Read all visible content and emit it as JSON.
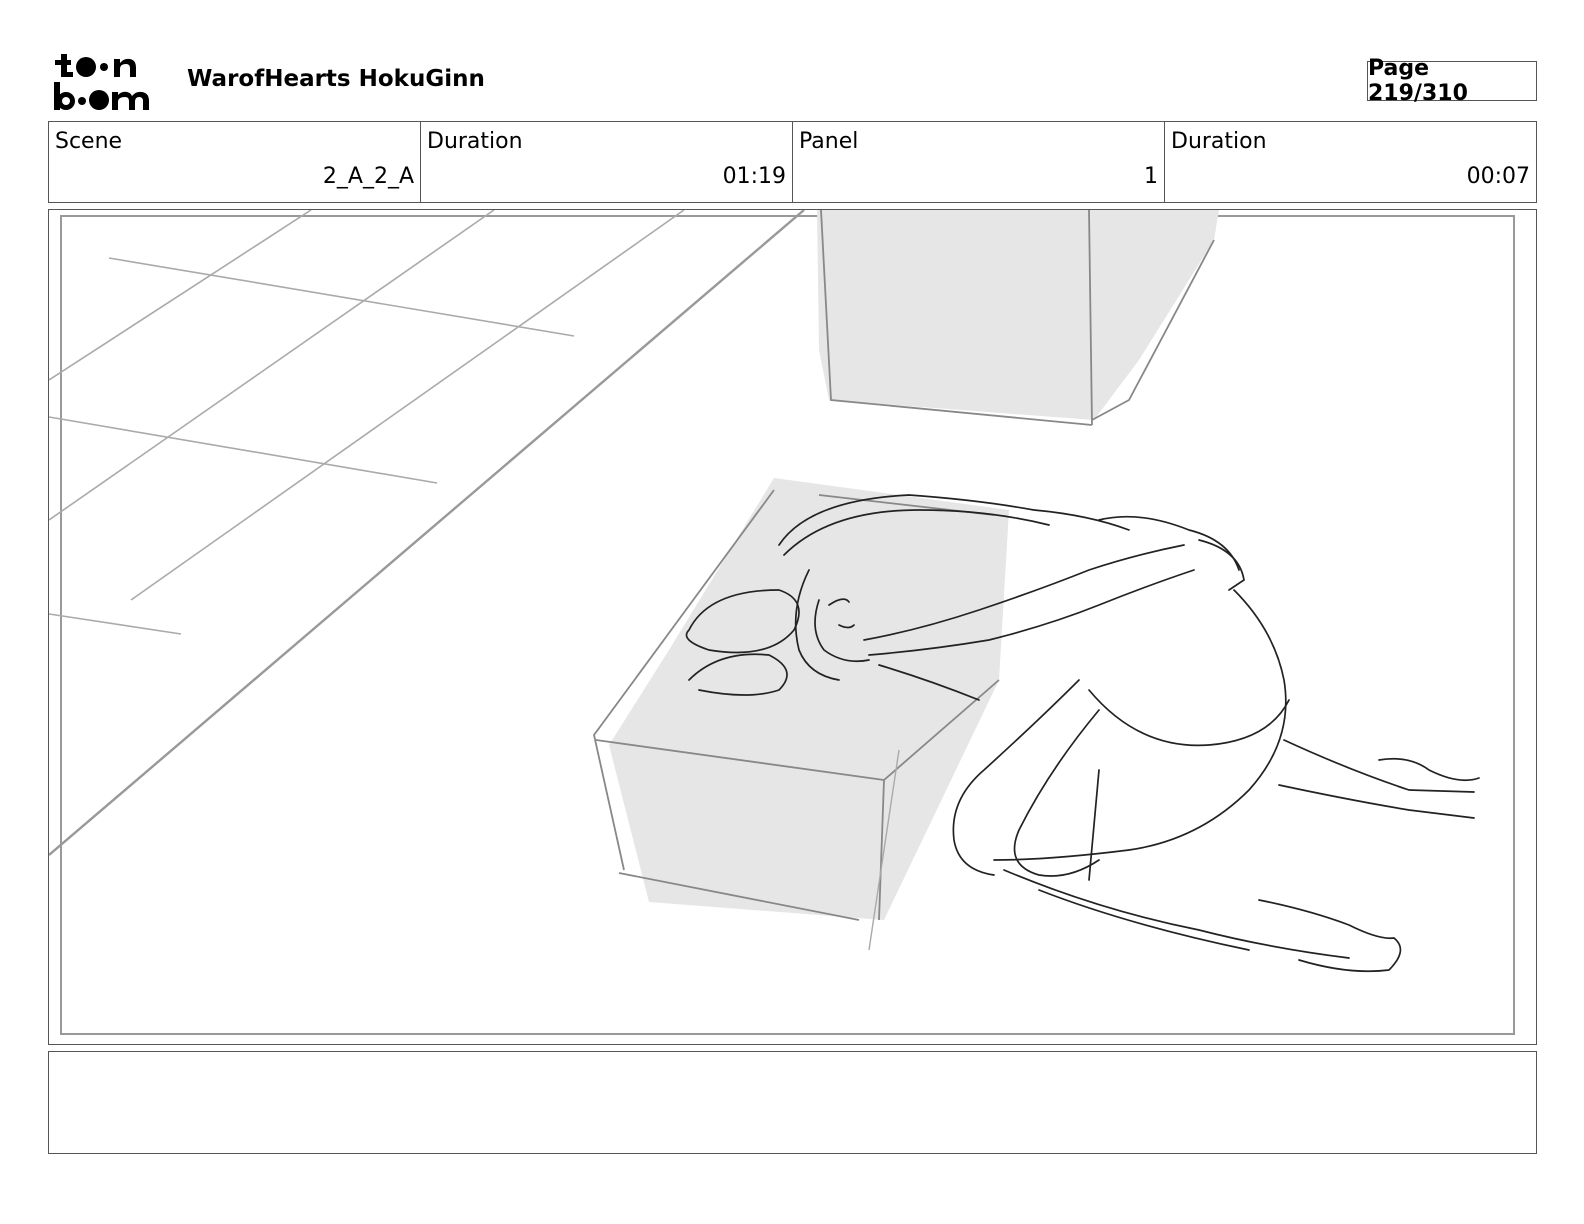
{
  "header": {
    "logo_text": "toon boom",
    "project_title": "WarofHearts HokuGinn",
    "page_label": "Page 219/310"
  },
  "info": {
    "scene_label": "Scene",
    "scene_value": "2_A_2_A",
    "scene_duration_label": "Duration",
    "scene_duration_value": "01:19",
    "panel_label": "Panel",
    "panel_value": "1",
    "panel_duration_label": "Duration",
    "panel_duration_value": "00:07"
  },
  "caption": {
    "text": ""
  }
}
